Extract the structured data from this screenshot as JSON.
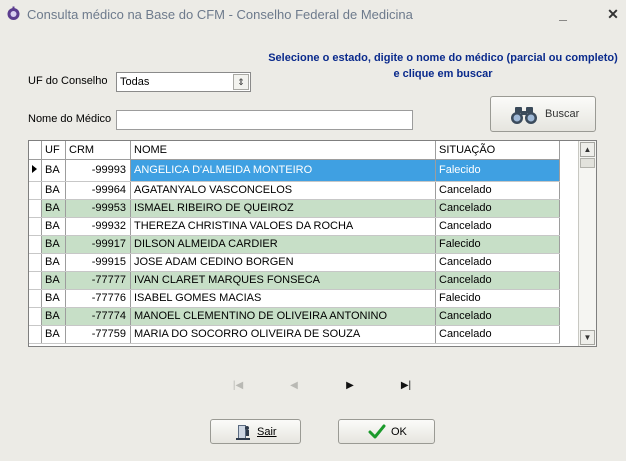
{
  "window": {
    "title": "Consulta médico na Base do CFM - Conselho Federal de Medicina",
    "minimize": "_",
    "close": "✕"
  },
  "hint": "Selecione o estado, digite o nome do médico (parcial ou completo) e clique em buscar",
  "form": {
    "uf_label": "UF do Conselho",
    "uf_value": "Todas",
    "nome_label": "Nome do Médico",
    "nome_value": "",
    "buscar_label": "Buscar"
  },
  "grid": {
    "columns": [
      "UF",
      "CRM",
      "NOME",
      "SITUAÇÃO"
    ],
    "rows": [
      {
        "uf": "BA",
        "crm": "-99993",
        "nome": "ANGELICA D'ALMEIDA MONTEIRO",
        "situacao": "Falecido"
      },
      {
        "uf": "BA",
        "crm": "-99964",
        "nome": "AGATANYALO VASCONCELOS",
        "situacao": "Cancelado"
      },
      {
        "uf": "BA",
        "crm": "-99953",
        "nome": "ISMAEL RIBEIRO DE QUEIROZ",
        "situacao": "Cancelado"
      },
      {
        "uf": "BA",
        "crm": "-99932",
        "nome": "THEREZA CHRISTINA VALOES DA ROCHA",
        "situacao": "Cancelado"
      },
      {
        "uf": "BA",
        "crm": "-99917",
        "nome": "DILSON ALMEIDA CARDIER",
        "situacao": "Falecido"
      },
      {
        "uf": "BA",
        "crm": "-99915",
        "nome": "JOSE ADAM CEDINO BORGEN",
        "situacao": "Cancelado"
      },
      {
        "uf": "BA",
        "crm": "-77777",
        "nome": "IVAN CLARET MARQUES FONSECA",
        "situacao": "Cancelado"
      },
      {
        "uf": "BA",
        "crm": "-77776",
        "nome": "ISABEL GOMES MACIAS",
        "situacao": "Falecido"
      },
      {
        "uf": "BA",
        "crm": "-77774",
        "nome": "MANOEL CLEMENTINO DE OLIVEIRA ANTONINO",
        "situacao": "Cancelado"
      },
      {
        "uf": "BA",
        "crm": "-77759",
        "nome": "MARIA DO SOCORRO OLIVEIRA DE SOUZA",
        "situacao": "Cancelado"
      }
    ]
  },
  "navigator": {
    "first": "|◀",
    "prior": "◀",
    "next": "▶",
    "last": "▶|"
  },
  "buttons": {
    "sair": "Sair",
    "ok": "OK"
  },
  "colors": {
    "selection": "#3fa0e2",
    "alt_row": "#c7dfc7",
    "hint_text": "#0a2a8c"
  }
}
